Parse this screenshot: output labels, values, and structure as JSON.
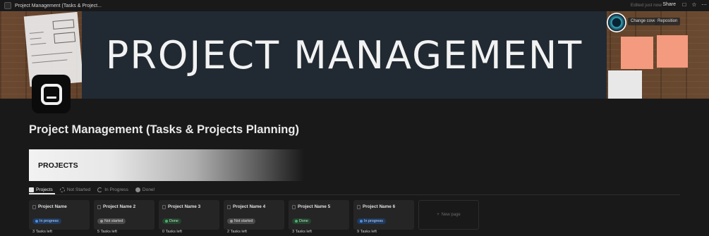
{
  "topbar": {
    "breadcrumb": "Project Management (Tasks & Project...",
    "edited": "Edited just now",
    "share": "Share"
  },
  "cover": {
    "headline": "PROJECT  MANAGEMENT",
    "change_cover": "Change cover",
    "reposition": "Reposition"
  },
  "page": {
    "title": "Project Management (Tasks & Projects Planning)",
    "banner": "PROJECTS"
  },
  "tabs": [
    {
      "label": "Projects",
      "active": true
    },
    {
      "label": "Not Started"
    },
    {
      "label": "In Progress"
    },
    {
      "label": "Done!"
    }
  ],
  "projects": [
    {
      "name": "Project Name",
      "status": "In progress",
      "tasks": "3 Tasks left"
    },
    {
      "name": "Project Name 2",
      "status": "Not started",
      "tasks": "5 Tasks left"
    },
    {
      "name": "Project Name 3",
      "status": "Done",
      "tasks": "0 Tasks left"
    },
    {
      "name": "Project Name 4",
      "status": "Not started",
      "tasks": "2 Tasks left"
    },
    {
      "name": "Project Name 5",
      "status": "Done",
      "tasks": "3 Tasks left"
    },
    {
      "name": "Project Name 6",
      "status": "In progress",
      "tasks": "9 Tasks left"
    }
  ],
  "new_page": "New page",
  "colors": {
    "background": "#191919",
    "card": "#252525",
    "in_progress": "#4a90e2",
    "not_started": "#9a9a9a",
    "done": "#4caf6e"
  }
}
